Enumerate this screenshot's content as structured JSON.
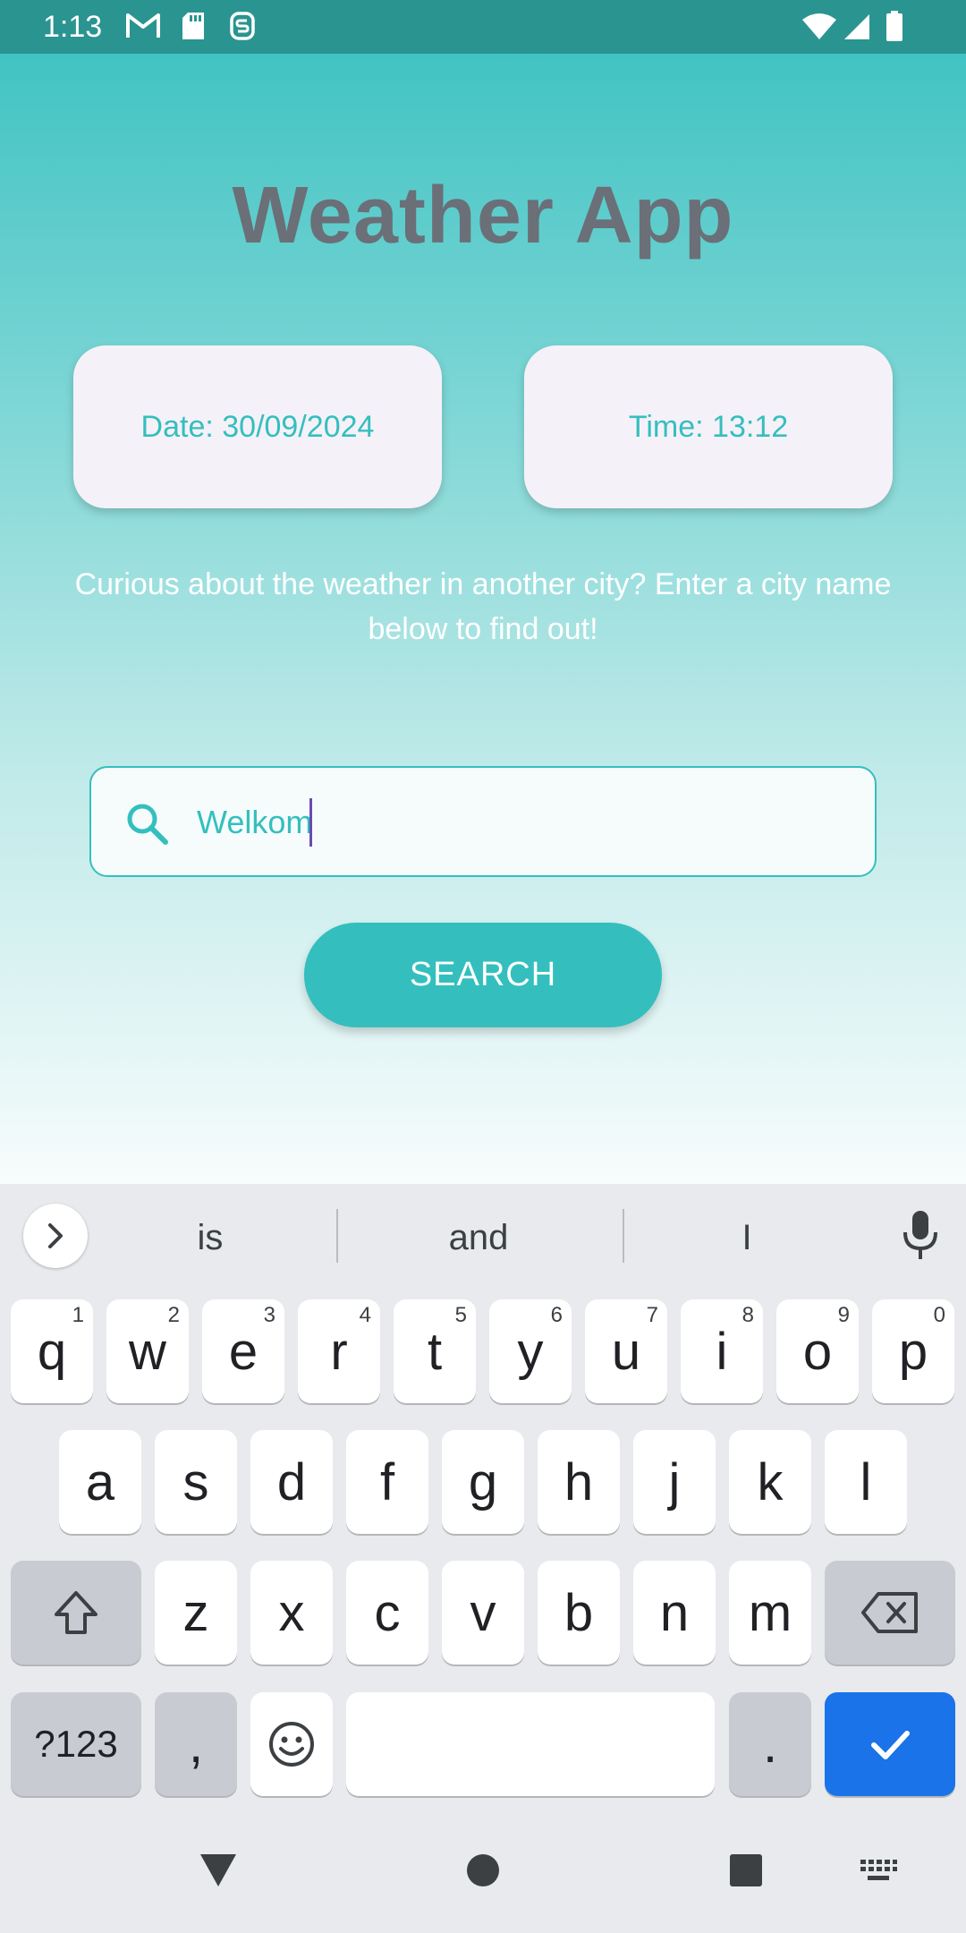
{
  "status_bar": {
    "time": "1:13"
  },
  "app": {
    "title": "Weather App",
    "date_label": "Date: 30/09/2024",
    "time_label": "Time: 13:12",
    "prompt": "Curious about the weather in another city? Enter a city name below to find out!",
    "search": {
      "value": "Welkom"
    },
    "search_button": "SEARCH",
    "colors": {
      "accent": "#34bfbe",
      "title": "#6b6f78",
      "status_bar": "#2a9490"
    }
  },
  "keyboard": {
    "suggestions": [
      "is",
      "and",
      "I"
    ],
    "row1": [
      {
        "label": "q",
        "hint": "1"
      },
      {
        "label": "w",
        "hint": "2"
      },
      {
        "label": "e",
        "hint": "3"
      },
      {
        "label": "r",
        "hint": "4"
      },
      {
        "label": "t",
        "hint": "5"
      },
      {
        "label": "y",
        "hint": "6"
      },
      {
        "label": "u",
        "hint": "7"
      },
      {
        "label": "i",
        "hint": "8"
      },
      {
        "label": "o",
        "hint": "9"
      },
      {
        "label": "p",
        "hint": "0"
      }
    ],
    "row2": [
      "a",
      "s",
      "d",
      "f",
      "g",
      "h",
      "j",
      "k",
      "l"
    ],
    "row3": [
      "z",
      "x",
      "c",
      "v",
      "b",
      "n",
      "m"
    ],
    "symbols_label": "?123",
    "comma_label": ",",
    "period_label": "."
  }
}
